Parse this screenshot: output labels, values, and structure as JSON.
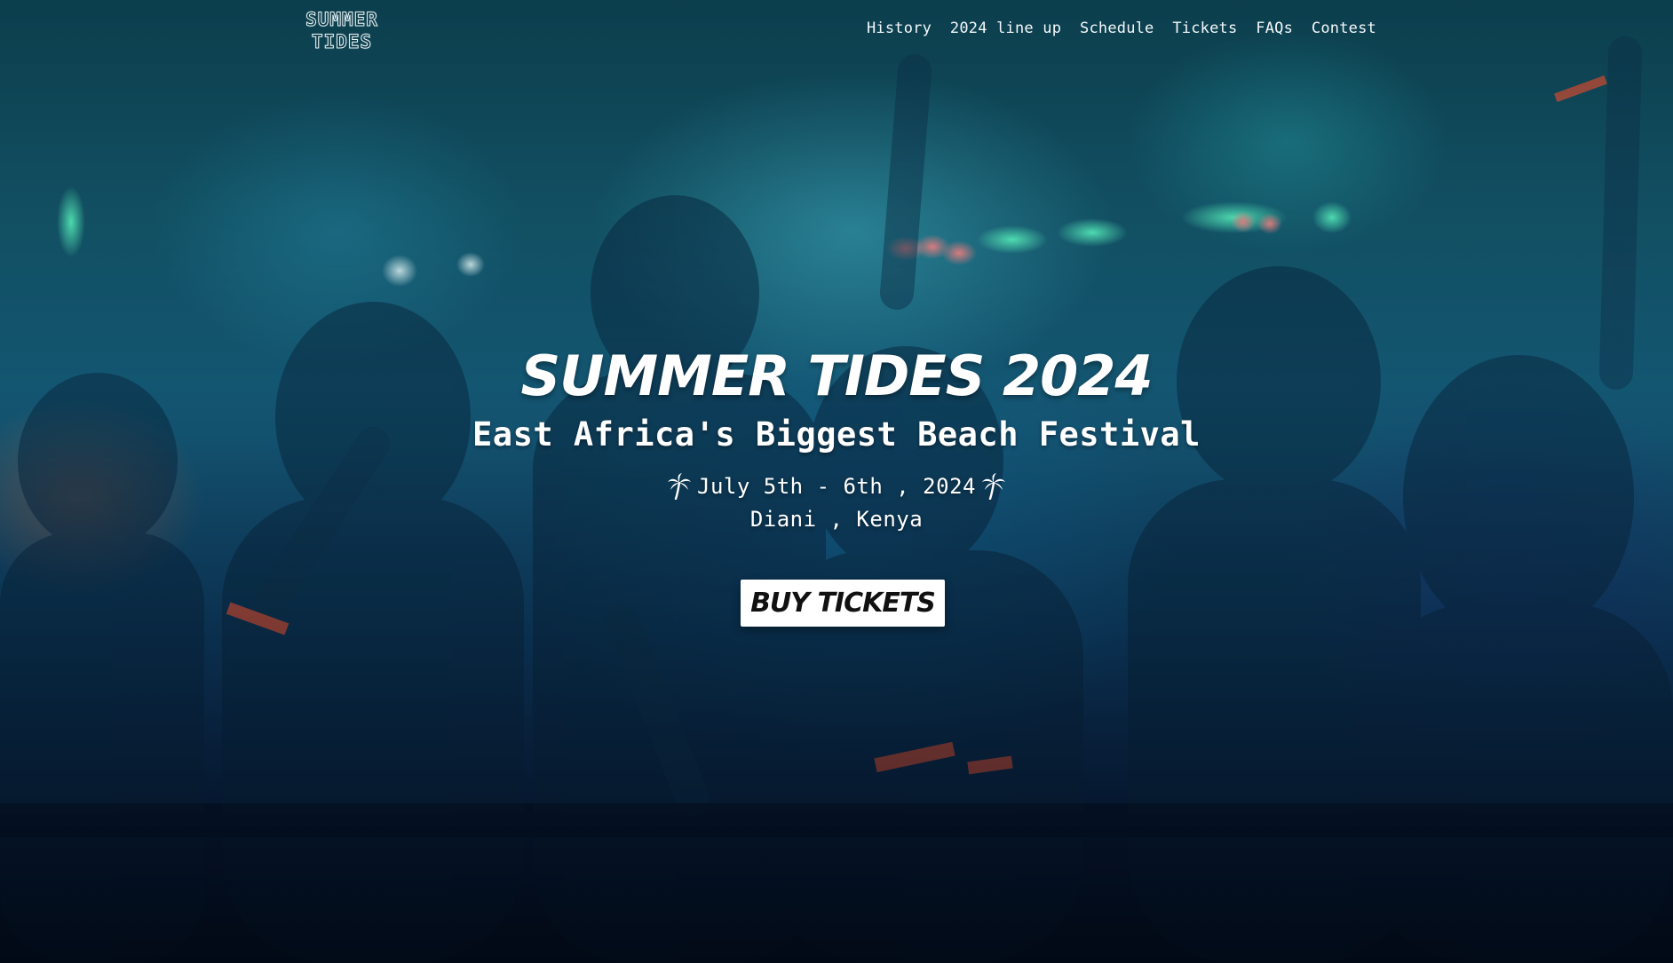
{
  "header": {
    "logo": {
      "line1": "SUMMER",
      "line2": "TIDES"
    },
    "nav": [
      {
        "label": "History"
      },
      {
        "label": "2024 line up"
      },
      {
        "label": "Schedule"
      },
      {
        "label": "Tickets"
      },
      {
        "label": "FAQs"
      },
      {
        "label": "Contest"
      }
    ]
  },
  "hero": {
    "title": "SUMMER TIDES 2024",
    "subtitle": "East Africa's Biggest Beach Festival",
    "dates": "July 5th - 6th , 2024",
    "location": "Diani , Kenya",
    "date_icon": "palm-tree-icon",
    "cta_label": "BUY TICKETS"
  },
  "colors": {
    "text": "#ffffff",
    "button_bg": "#ffffff",
    "button_text": "#111111",
    "background_tint": "#155a78"
  }
}
